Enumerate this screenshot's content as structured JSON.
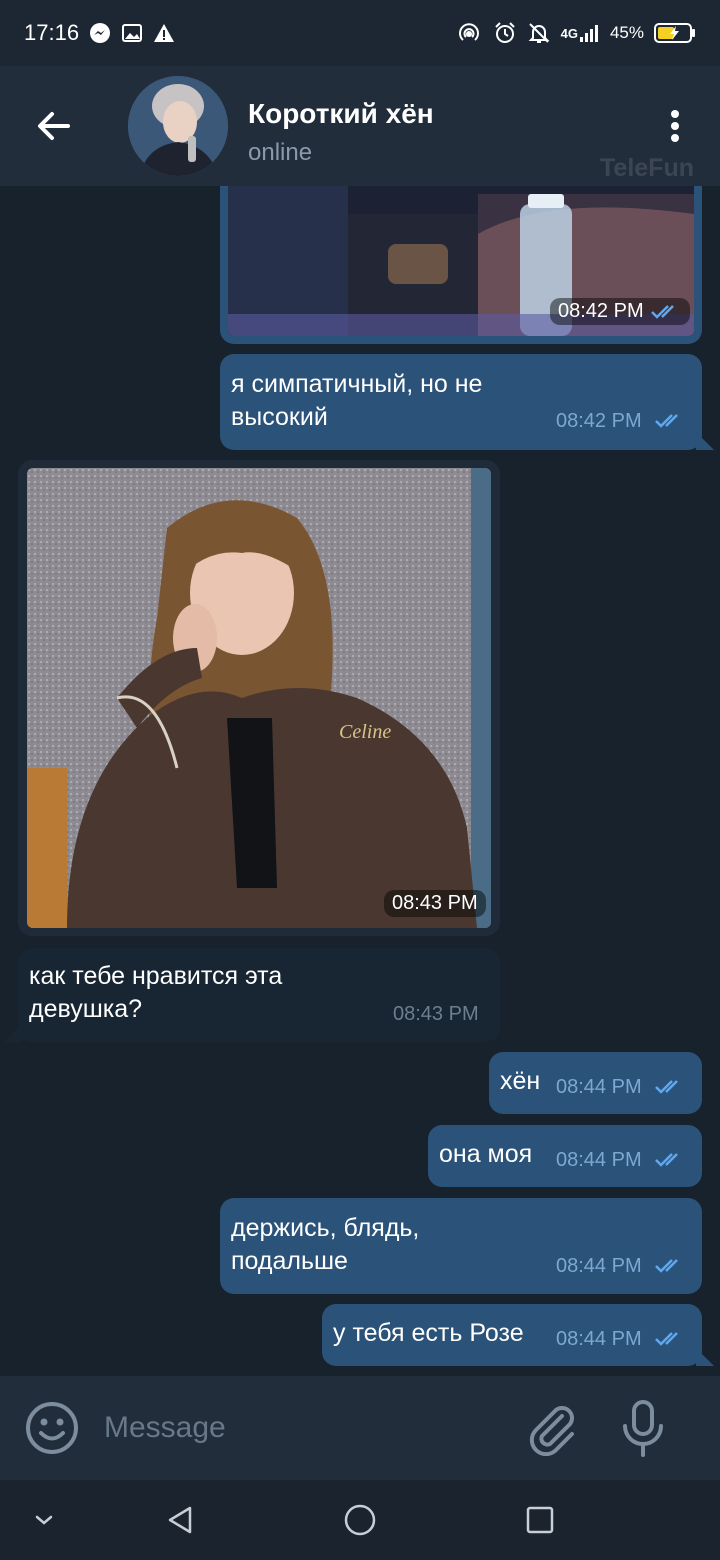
{
  "status_bar": {
    "time": "17:16",
    "network": "4G",
    "battery": "45%"
  },
  "header": {
    "title": "Короткий хён",
    "status": "online",
    "watermark": "TeleFun"
  },
  "messages": [
    {
      "id": "m1",
      "type": "photo",
      "direction": "out",
      "time": "08:42 PM",
      "read": true
    },
    {
      "id": "m2",
      "type": "text",
      "direction": "out",
      "text": "я симпатичный, но не\nвысокий",
      "time": "08:42 PM",
      "read": true
    },
    {
      "id": "m3",
      "type": "photo",
      "direction": "in",
      "time": "08:43 PM",
      "photo_label": "Celine"
    },
    {
      "id": "m4",
      "type": "text",
      "direction": "in",
      "text": "как тебе нравится эта\nдевушка?",
      "time": "08:43 PM"
    },
    {
      "id": "m5",
      "type": "text",
      "direction": "out",
      "text": "хён",
      "time": "08:44 PM",
      "read": true
    },
    {
      "id": "m6",
      "type": "text",
      "direction": "out",
      "text": "она моя",
      "time": "08:44 PM",
      "read": true
    },
    {
      "id": "m7",
      "type": "text",
      "direction": "out",
      "text": "держись, блядь,\nподальше",
      "time": "08:44 PM",
      "read": true
    },
    {
      "id": "m8",
      "type": "text",
      "direction": "out",
      "text": "у тебя есть Розе",
      "time": "08:44 PM",
      "read": true
    }
  ],
  "input": {
    "placeholder": "Message"
  },
  "icons": {
    "back": "arrow-left-icon",
    "menu": "more-vertical-icon",
    "emoji": "emoji-icon",
    "attach": "paperclip-icon",
    "mic": "microphone-icon",
    "read_receipt": "double-check-icon"
  },
  "colors": {
    "background": "#18222d",
    "header": "#212d3b",
    "outgoing_bubble": "#2b5278",
    "incoming_bubble": "#182533",
    "read_check": "#5fa8f0",
    "time_out": "#7da8d3"
  }
}
